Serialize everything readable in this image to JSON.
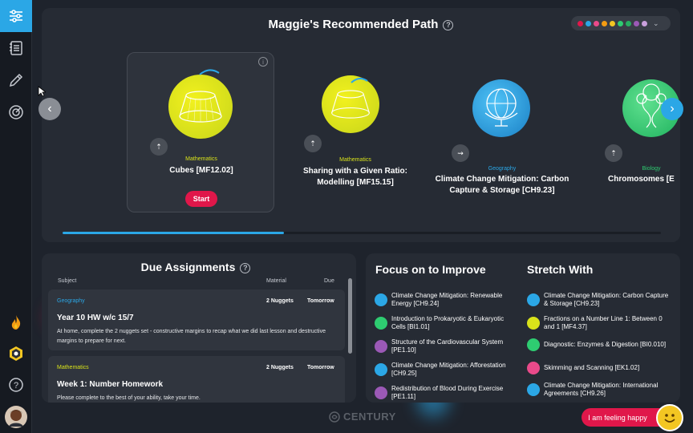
{
  "header": {
    "title": "Maggie's Recommended Path"
  },
  "subject_filter_colors": [
    "#e0174a",
    "#2ba7e6",
    "#e94a8a",
    "#f39c12",
    "#f3c622",
    "#2ecc71",
    "#27ae60",
    "#9b59b6",
    "#c9a0dc"
  ],
  "path_progress": 0.37,
  "cards": [
    {
      "subject": "Mathematics",
      "name": "Cubes [MF12.02]",
      "subject_color": "#d8e21a",
      "active": true,
      "start_label": "Start"
    },
    {
      "subject": "Mathematics",
      "name": "Sharing with a Given Ratio: Modelling [MF15.15]",
      "subject_color": "#d8e21a"
    },
    {
      "subject": "Geography",
      "name": "Climate Change Mitigation: Carbon Capture & Storage [CH9.23]",
      "subject_color": "#2ba7e6"
    },
    {
      "subject": "Biology",
      "name": "Chromosomes [E",
      "subject_color": "#2ecc71"
    }
  ],
  "due": {
    "title": "Due Assignments",
    "col_subject": "Subject",
    "col_material": "Material",
    "col_due": "Due",
    "assignments": [
      {
        "subject": "Geography",
        "subject_color": "#2ba7e6",
        "nuggets": "2 Nuggets",
        "due": "Tomorrow",
        "title": "Year 10 HW w/c 15/7",
        "description": "At home, complete the 2 nuggets set - constructive margins to recap what we did last lesson and destructive margins to prepare for next."
      },
      {
        "subject": "Mathematics",
        "subject_color": "#d8e21a",
        "nuggets": "2 Nuggets",
        "due": "Tomorrow",
        "title": "Week 1: Number Homework",
        "description": "Please complete to the best of your ability, take your time."
      }
    ]
  },
  "focus": {
    "title": "Focus on to Improve",
    "items": [
      {
        "text": "Climate Change Mitigation: Renewable Energy [CH9.24]",
        "color": "#2ba7e6"
      },
      {
        "text": "Introduction to Prokaryotic & Eukaryotic Cells [BI1.01]",
        "color": "#2ecc71"
      },
      {
        "text": "Structure of the Cardiovascular System [PE1.10]",
        "color": "#9b59b6"
      },
      {
        "text": "Climate Change Mitigation: Afforestation [CH9.25]",
        "color": "#2ba7e6"
      },
      {
        "text": "Redistribution of Blood During Exercise [PE1.11]",
        "color": "#9b59b6"
      }
    ]
  },
  "stretch": {
    "title": "Stretch With",
    "items": [
      {
        "text": "Climate Change Mitigation: Carbon Capture & Storage [CH9.23]",
        "color": "#2ba7e6"
      },
      {
        "text": "Fractions on a Number Line 1: Between 0 and 1 [MF4.37]",
        "color": "#d8e21a"
      },
      {
        "text": "Diagnostic: Enzymes & Digestion [BI0.010]",
        "color": "#2ecc71"
      },
      {
        "text": "Skimming and Scanning [EK1.02]",
        "color": "#e94a8a"
      },
      {
        "text": "Climate Change Mitigation: International Agreements [CH9.26]",
        "color": "#2ba7e6"
      }
    ]
  },
  "footer": {
    "brand": "CENTURY",
    "feeling_label": "I am feeling happy"
  }
}
